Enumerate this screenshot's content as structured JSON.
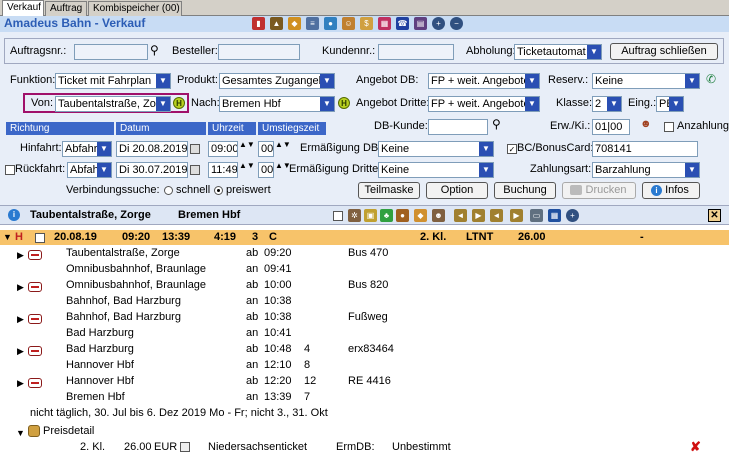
{
  "tabs": [
    "Verkauf",
    "Auftrag",
    "Kombispeicher (00)"
  ],
  "app_title": "Amadeus Bahn - Verkauf",
  "order": {
    "auftragsnr_label": "Auftragsnr.:",
    "besteller_label": "Besteller:",
    "kundennr_label": "Kundennr.:",
    "abholung_label": "Abholung:",
    "abholung_value": "Ticketautomat",
    "close_button": "Auftrag schließen"
  },
  "form": {
    "funktion_label": "Funktion:",
    "funktion_value": "Ticket mit Fahrplan",
    "produkt_label": "Produkt:",
    "produkt_value": "Gesamtes Zugangebo",
    "angebot_db_label": "Angebot DB:",
    "angebot_db_value": "FP + weit. Angebote",
    "reserv_label": "Reserv.:",
    "reserv_value": "Keine",
    "von_label": "Von:",
    "von_value": "Taubentalstraße, Zorg",
    "nach_label": "Nach:",
    "nach_value": "Bremen Hbf",
    "angebot_dritte_label": "Angebot Dritte:",
    "angebot_dritte_value": "FP + weit. Angebote",
    "klasse_label": "Klasse:",
    "klasse_value": "2",
    "eing_label": "Eing.:",
    "eing_value": "PE",
    "h_label": "H",
    "db_kunde_label": "DB-Kunde:",
    "erw_ki_label": "Erw./Ki.:",
    "erw_ki_value": "01|00",
    "anzahlung_label": "Anzahlung",
    "col_richtung": "Richtung",
    "col_datum": "Datum",
    "col_uhrzeit": "Uhrzeit",
    "col_umstiegszeit": "Umstiegszeit",
    "hinfahrt_label": "Hinfahrt:",
    "hinfahrt_type": "Abfahrt",
    "hinfahrt_date": "Di 20.08.2019",
    "hinfahrt_time": "09:00",
    "hinfahrt_umstieg": "00",
    "erm_db_label": "Ermäßigung DB:",
    "erm_db_value": "Keine",
    "bc_label": "BC/BonusCard:",
    "bc_value": "708141",
    "rueckfahrt_label": "Rückfahrt:",
    "rueckfahrt_type": "Abfahrt",
    "rueckfahrt_date": "Di 30.07.2019",
    "rueckfahrt_time": "11:49",
    "rueckfahrt_umstieg": "00",
    "erm_dritte_label": "Ermäßigung Dritte:",
    "erm_dritte_value": "Keine",
    "zahlungsart_label": "Zahlungsart:",
    "zahlungsart_value": "Barzahlung",
    "verbindungssuche_label": "Verbindungssuche:",
    "schnell_label": "schnell",
    "preiswert_label": "preiswert"
  },
  "buttons": {
    "teilmaske": "Teilmaske",
    "option": "Option",
    "buchung": "Buchung",
    "drucken": "Drucken",
    "infos": "Infos"
  },
  "results": {
    "from": "Taubentalstraße, Zorge",
    "to": "Bremen Hbf",
    "summary": {
      "marker": "H",
      "date": "20.08.19",
      "dep": "09:20",
      "arr": "13:39",
      "duration": "4:19",
      "changes": "3",
      "c": "C",
      "klasse": "2. Kl.",
      "products": "LTNT",
      "price": "26.00",
      "dash": "-"
    },
    "legs": [
      {
        "from": "Taubentalstraße, Zorge",
        "to": "Omnibusbahnhof, Braunlage",
        "dep_label": "ab",
        "dep": "09:20",
        "arr_label": "an",
        "arr": "09:41",
        "dep_platform": "",
        "arr_platform": "",
        "train": "Bus  470"
      },
      {
        "from": "Omnibusbahnhof, Braunlage",
        "to": "Bahnhof, Bad Harzburg",
        "dep_label": "ab",
        "dep": "10:00",
        "arr_label": "an",
        "arr": "10:38",
        "dep_platform": "",
        "arr_platform": "",
        "train": "Bus  820"
      },
      {
        "from": "Bahnhof, Bad Harzburg",
        "to": "Bad Harzburg",
        "dep_label": "ab",
        "dep": "10:38",
        "arr_label": "an",
        "arr": "10:41",
        "dep_platform": "",
        "arr_platform": "",
        "train": "Fußweg"
      },
      {
        "from": "Bad Harzburg",
        "to": "Hannover Hbf",
        "dep_label": "ab",
        "dep": "10:48",
        "arr_label": "an",
        "arr": "12:10",
        "dep_platform": "4",
        "arr_platform": "8",
        "train": "erx83464"
      },
      {
        "from": "Hannover Hbf",
        "to": "Bremen Hbf",
        "dep_label": "ab",
        "dep": "12:20",
        "arr_label": "an",
        "arr": "13:39",
        "dep_platform": "12",
        "arr_platform": "7",
        "train": "RE  4416"
      }
    ],
    "note": "nicht täglich, 30. Jul bis 6. Dez 2019 Mo - Fr; nicht 3., 31. Okt",
    "preisdetail_label": "Preisdetail",
    "price_row": {
      "klasse": "2. Kl.",
      "price": "26.00",
      "currency": "EUR",
      "ticket": "Niedersachsenticket",
      "ermdb_label": "ErmDB:",
      "ermdb_value": "Unbestimmt"
    }
  },
  "colors": {
    "accent": "#2a4fb3",
    "title": "#2c5db5",
    "highlight": "#f7c36a",
    "von_border": "#a0106a"
  }
}
